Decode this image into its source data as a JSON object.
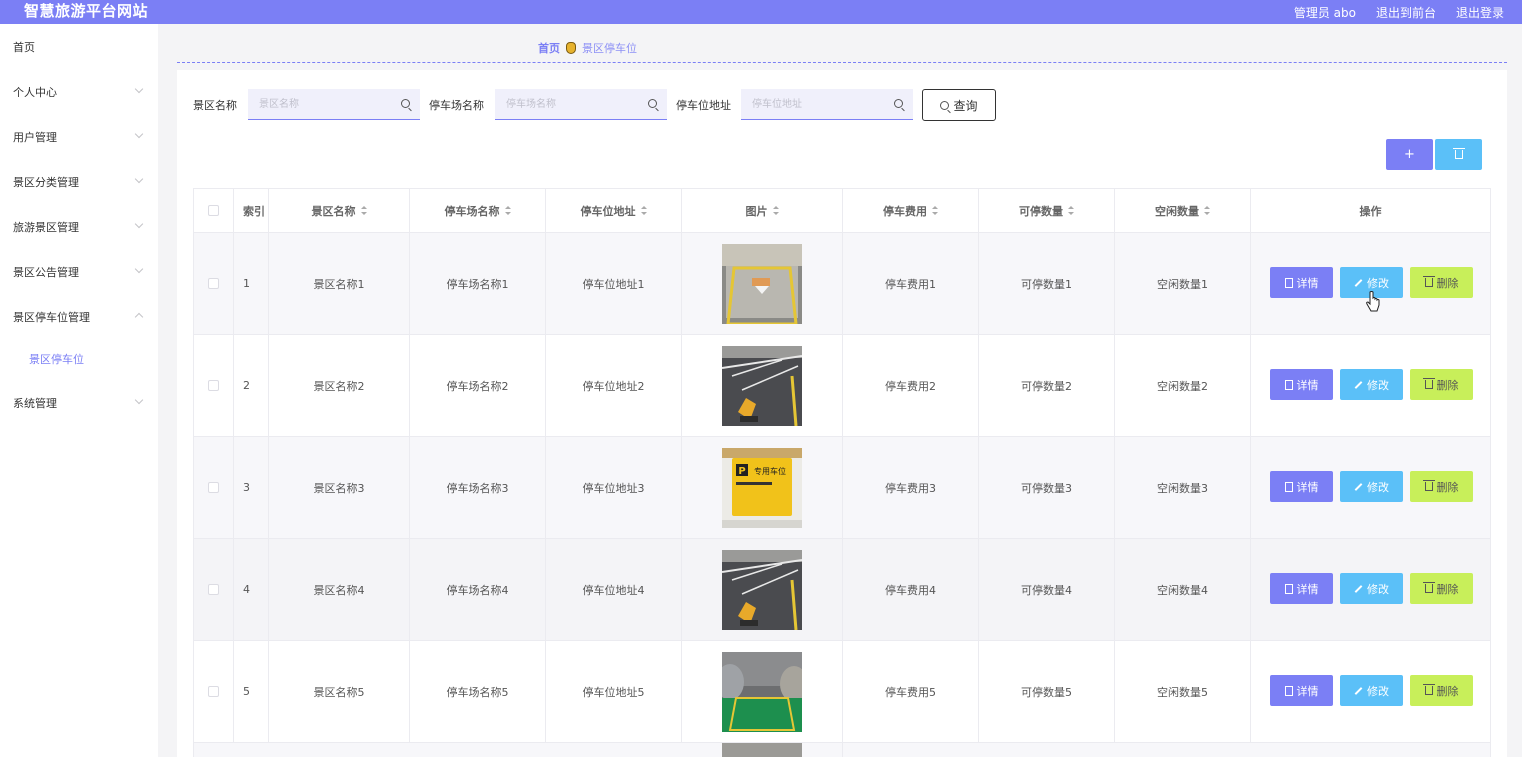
{
  "header": {
    "site_title": "智慧旅游平台网站",
    "user": "管理员 abo",
    "to_front": "退出到前台",
    "logout": "退出登录"
  },
  "sidebar": {
    "items": [
      {
        "label": "首页"
      },
      {
        "label": "个人中心"
      },
      {
        "label": "用户管理"
      },
      {
        "label": "景区分类管理"
      },
      {
        "label": "旅游景区管理"
      },
      {
        "label": "景区公告管理"
      },
      {
        "label": "景区停车位管理"
      },
      {
        "label": "系统管理"
      }
    ],
    "sub_item": "景区停车位"
  },
  "breadcrumb": {
    "home": "首页",
    "current": "景区停车位"
  },
  "search": {
    "fields": [
      {
        "label": "景区名称",
        "placeholder": "景区名称"
      },
      {
        "label": "停车场名称",
        "placeholder": "停车场名称"
      },
      {
        "label": "停车位地址",
        "placeholder": "停车位地址"
      }
    ],
    "query_label": "查询"
  },
  "toolbar": {
    "add_label": "+"
  },
  "table": {
    "columns": [
      "索引",
      "景区名称",
      "停车场名称",
      "停车位地址",
      "图片",
      "停车费用",
      "可停数量",
      "空闲数量",
      "操作"
    ],
    "rows": [
      {
        "index": "1",
        "scenic": "景区名称1",
        "lot": "停车场名称1",
        "address": "停车位地址1",
        "fee": "停车费用1",
        "capacity": "可停数量1",
        "free": "空闲数量1"
      },
      {
        "index": "2",
        "scenic": "景区名称2",
        "lot": "停车场名称2",
        "address": "停车位地址2",
        "fee": "停车费用2",
        "capacity": "可停数量2",
        "free": "空闲数量2"
      },
      {
        "index": "3",
        "scenic": "景区名称3",
        "lot": "停车场名称3",
        "address": "停车位地址3",
        "fee": "停车费用3",
        "capacity": "可停数量3",
        "free": "空闲数量3"
      },
      {
        "index": "4",
        "scenic": "景区名称4",
        "lot": "停车场名称4",
        "address": "停车位地址4",
        "fee": "停车费用4",
        "capacity": "可停数量4",
        "free": "空闲数量4"
      },
      {
        "index": "5",
        "scenic": "景区名称5",
        "lot": "停车场名称5",
        "address": "停车位地址5",
        "fee": "停车费用5",
        "capacity": "可停数量5",
        "free": "空闲数量5"
      }
    ],
    "actions": {
      "detail": "详情",
      "edit": "修改",
      "delete": "删除"
    },
    "sign_text": "专用车位"
  },
  "colors": {
    "primary": "#7b7ff5",
    "info": "#5bc0f8",
    "warn": "#c8ef5a"
  }
}
